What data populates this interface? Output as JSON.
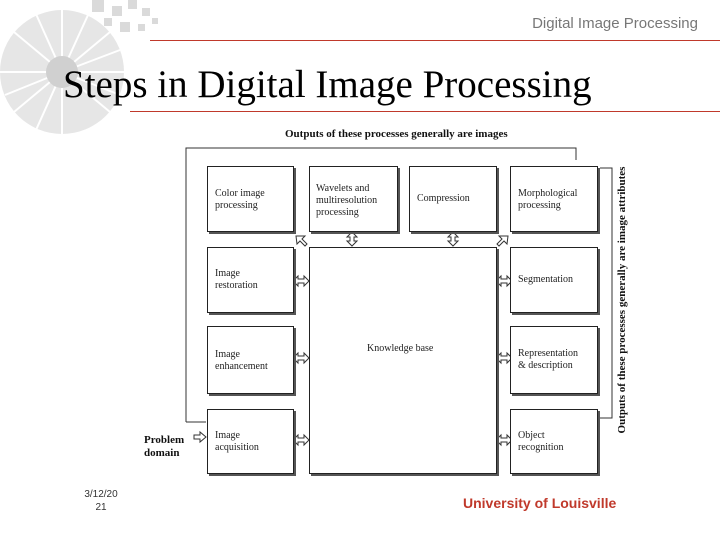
{
  "header": {
    "subtitle": "Digital Image Processing"
  },
  "slide": {
    "title": "Steps in Digital Image Processing"
  },
  "diagram": {
    "top_caption": "Outputs of these processes generally are images",
    "side_caption": "Outputs of these processes generally are image attributes",
    "problem_domain": "Problem\ndomain",
    "boxes": {
      "color": "Color image\nprocessing",
      "wavelets": "Wavelets and\nmultiresolution\nprocessing",
      "compression": "Compression",
      "morphological": "Morphological\nprocessing",
      "restoration": "Image\nrestoration",
      "segmentation": "Segmentation",
      "enhancement": "Image\nenhancement",
      "knowledge": "Knowledge base",
      "representation": "Representation\n& description",
      "acquisition": "Image\nacquisition",
      "recognition": "Object\nrecognition"
    }
  },
  "footer": {
    "date": "3/12/20\n21",
    "university": "University of Louisville"
  }
}
